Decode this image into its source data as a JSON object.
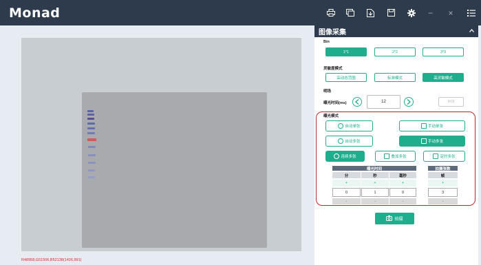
{
  "app": {
    "logo": "Monad"
  },
  "toolbar": {
    "icons": [
      "print-icon",
      "window-icon",
      "export-icon",
      "save-icon",
      "gear-icon",
      "minimize-icon",
      "close-icon",
      "menu-list-icon"
    ],
    "minimize_label": "−",
    "close_label": "×"
  },
  "viewer": {
    "status_text": "R48958,G51506,B52138(1426,991)"
  },
  "panel": {
    "title": "图像采集",
    "bin": {
      "label": "Bin",
      "options": [
        "1*1",
        "2*2",
        "3*3"
      ],
      "selected": "1*1"
    },
    "sensitivity": {
      "label": "灵敏度模式",
      "options": [
        "高动态范围",
        "标准模式",
        "高灵敏模式"
      ],
      "selected": "高灵敏模式"
    },
    "focus": {
      "label": "明场",
      "exposure_label": "曝光时间(ms)",
      "exposure_value": "12",
      "roi_label": "ROI"
    },
    "exposure_mode": {
      "label": "曝光模式",
      "auto_single": "自动单张",
      "manual_single": "手动单张",
      "auto_multi": "自动多张",
      "manual_multi": "手动多张",
      "continuous_multi": "连续多张",
      "overlay_multi": "叠加多张",
      "timed_multi": "定时多张"
    },
    "grid": {
      "exposure_time_header": "曝光时间",
      "shot_count_header": "拍摄张数",
      "cols": [
        "分",
        "秒",
        "毫秒"
      ],
      "frame_col": "帧",
      "plus": "+",
      "minus": "-",
      "values": {
        "min": "0",
        "sec": "1",
        "ms": "0",
        "frames": "3"
      }
    },
    "shoot_label": "拍摄"
  },
  "colors": {
    "accent": "#1fae8d",
    "titlebar": "#2e3b4c",
    "highlight_red": "#c0282d",
    "status_red": "#e0252b"
  }
}
